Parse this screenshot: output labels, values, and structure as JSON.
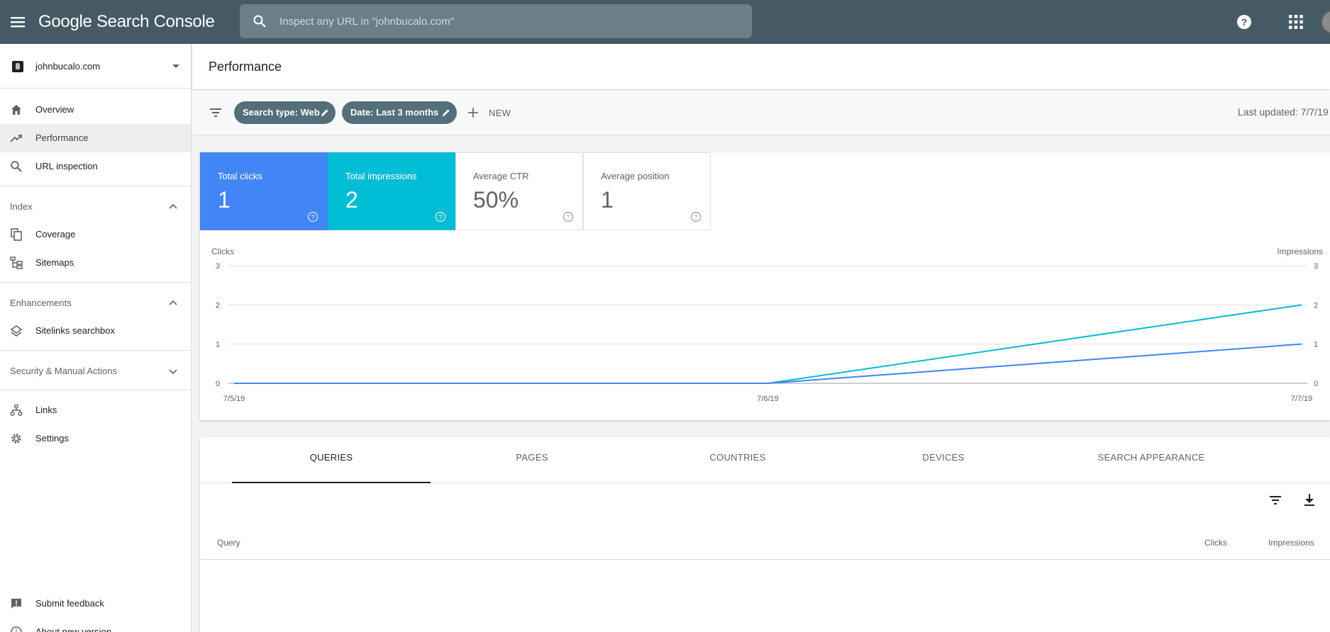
{
  "app": {
    "title": "Google Search Console"
  },
  "search": {
    "placeholder": "Inspect any URL in \"johnbucalo.com\""
  },
  "property": {
    "name": "johnbucalo.com"
  },
  "sidebar": {
    "overview": "Overview",
    "performance": "Performance",
    "url_inspection": "URL inspection",
    "index_section": "Index",
    "coverage": "Coverage",
    "sitemaps": "Sitemaps",
    "enhancements_section": "Enhancements",
    "sitelinks": "Sitelinks searchbox",
    "security_section": "Security & Manual Actions",
    "links": "Links",
    "settings": "Settings",
    "submit_feedback": "Submit feedback",
    "about_new_version": "About new version"
  },
  "page": {
    "title": "Performance"
  },
  "filters": {
    "search_type": "Search type: Web",
    "date": "Date: Last 3 months",
    "new_label": "NEW",
    "last_updated": "Last updated: 7/7/19"
  },
  "metrics": {
    "total_clicks": {
      "label": "Total clicks",
      "value": "1"
    },
    "total_impressions": {
      "label": "Total impressions",
      "value": "2"
    },
    "average_ctr": {
      "label": "Average CTR",
      "value": "50%"
    },
    "average_position": {
      "label": "Average position",
      "value": "1"
    }
  },
  "colors": {
    "clicks": "#4285f4",
    "impressions": "#00bcd4",
    "topbar": "#455a64"
  },
  "chart_data": {
    "type": "line",
    "x": [
      "7/5/19",
      "7/6/19",
      "7/7/19"
    ],
    "series": [
      {
        "name": "Clicks",
        "axis": "left",
        "values": [
          0,
          0,
          1
        ],
        "color": "#4285f4"
      },
      {
        "name": "Impressions",
        "axis": "right",
        "values": [
          0,
          0,
          2
        ],
        "color": "#00bcd4"
      }
    ],
    "ylabel_left": "Clicks",
    "ylabel_right": "Impressions",
    "yticks": [
      0,
      1,
      2,
      3
    ],
    "ylim": [
      0,
      3
    ],
    "grid": true
  },
  "tabs": [
    "QUERIES",
    "PAGES",
    "COUNTRIES",
    "DEVICES",
    "SEARCH APPEARANCE"
  ],
  "table": {
    "columns": [
      "Query",
      "Clicks",
      "Impressions"
    ]
  }
}
